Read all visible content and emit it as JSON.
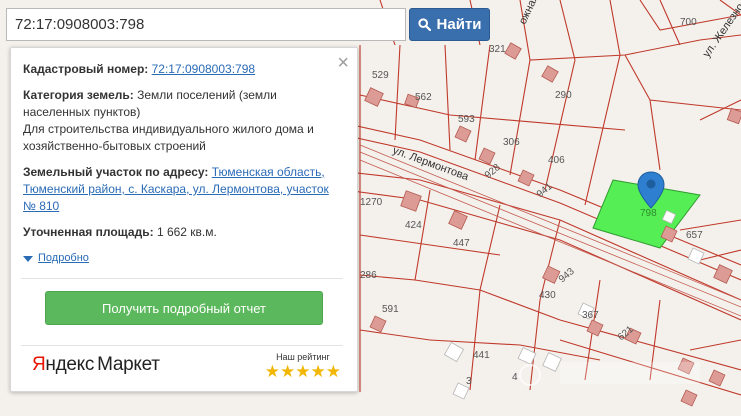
{
  "search": {
    "value": "72:17:0908003:798",
    "button_label": "Найти"
  },
  "info_panel": {
    "close_glyph": "×",
    "cadastral": {
      "label": "Кадастровый номер:",
      "value": "72:17:0908003:798"
    },
    "land_category": {
      "label": "Категория земель:",
      "value": "Земли поселений (земли населенных пунктов)",
      "usage": "Для строительства индивидуального жилого дома и хозяйственно-бытовых строений"
    },
    "address": {
      "label": "Земельный участок по адресу:",
      "value": "Тюменская область, Тюменский район, с. Каскара, ул. Лермонтова, участок № 810"
    },
    "area": {
      "label": "Уточненная площадь:",
      "value": "1 662 кв.м."
    },
    "more_link": "Подробно",
    "report_button": "Получить подробный отчет",
    "ad": {
      "logo_part1": "Я",
      "logo_part2": "ндекс",
      "logo_part3": "Маркет",
      "rating_label": "Наш рейтинг",
      "stars": "★★★★★",
      "rating_value": 5
    }
  },
  "map": {
    "streets": [
      "ул. Лермонтова",
      "ожная ул.",
      "ул. Железно"
    ],
    "parcel_numbers": [
      "700",
      "321",
      "529",
      "562",
      "290",
      "593",
      "306",
      "406",
      "928",
      "941",
      "1270",
      "424",
      "447",
      "798",
      "657",
      "943",
      "286",
      "591",
      "430",
      "367",
      "621",
      "441",
      "3",
      "4"
    ],
    "selected_parcel": "798",
    "colors": {
      "selected_fill": "#55ee55",
      "boundary": "#c0392b",
      "building": "#dd9b95",
      "marker": "#2f7fd0"
    }
  }
}
